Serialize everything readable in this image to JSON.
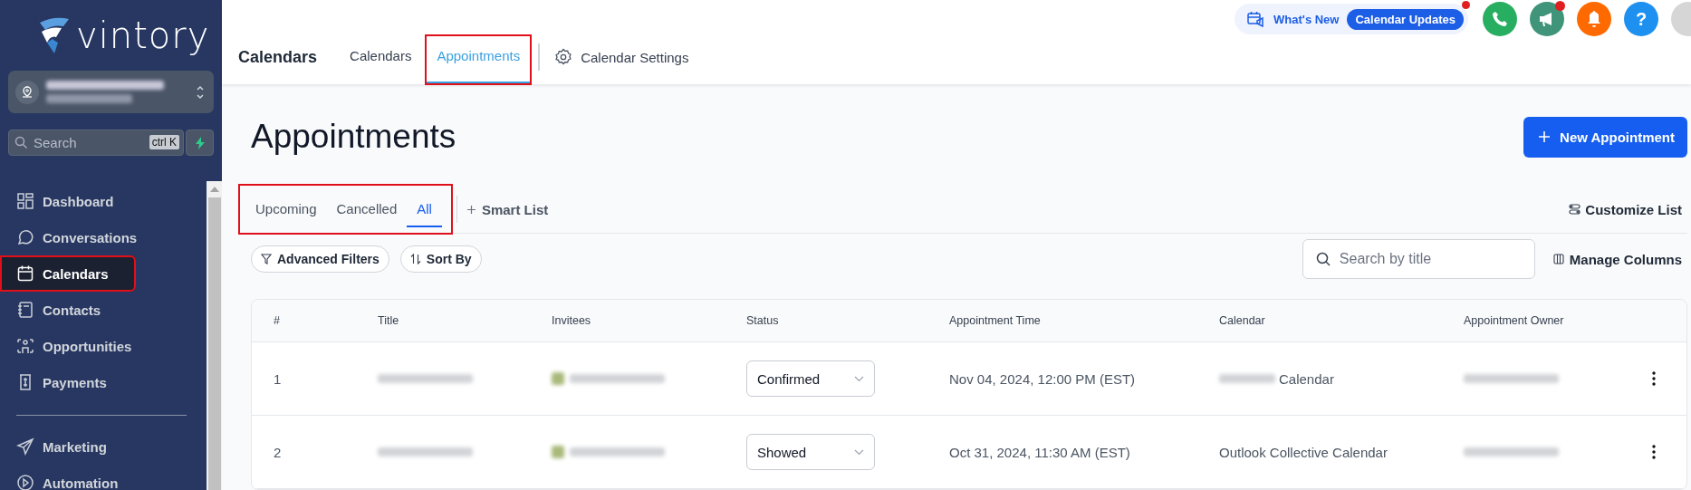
{
  "sidebar": {
    "logo": "vintory",
    "account": {
      "blurred": true
    },
    "search": {
      "placeholder": "Search",
      "shortcut": "ctrl K"
    },
    "items": [
      {
        "label": "Dashboard",
        "selected": false,
        "annotated": false
      },
      {
        "label": "Conversations",
        "selected": false,
        "annotated": false
      },
      {
        "label": "Calendars",
        "selected": true,
        "annotated": true
      },
      {
        "label": "Contacts",
        "selected": false,
        "annotated": false
      },
      {
        "label": "Opportunities",
        "selected": false,
        "annotated": false
      },
      {
        "label": "Payments",
        "selected": false,
        "annotated": false
      },
      {
        "kind": "divider"
      },
      {
        "label": "Marketing",
        "selected": false,
        "annotated": false
      },
      {
        "label": "Automation",
        "selected": false,
        "annotated": false
      }
    ]
  },
  "header": {
    "title": "Calendars",
    "tabs": [
      {
        "label": "Calendars",
        "selected": false,
        "annotated": false
      },
      {
        "label": "Appointments",
        "selected": true,
        "annotated": true
      }
    ],
    "settings": "Calendar Settings",
    "whats_new": {
      "label": "What's New",
      "badge": "Calendar Updates",
      "dot": true
    },
    "circle_buttons": [
      {
        "color": "#27ae60",
        "dot": false
      },
      {
        "color": "#3f9479",
        "dot": true
      },
      {
        "color": "#ff6a00",
        "dot": false
      },
      {
        "color": "#1e90f0",
        "dot": false,
        "text": "?"
      },
      {
        "color": "#d6d6d6",
        "dot": false
      }
    ]
  },
  "page": {
    "title": "Appointments",
    "new_button": "New Appointment",
    "list_tabs": [
      {
        "label": "Upcoming",
        "selected": false
      },
      {
        "label": "Cancelled",
        "selected": false
      },
      {
        "label": "All",
        "selected": true
      }
    ],
    "list_tabs_annotated": true,
    "smart_list": "Smart List",
    "customize": "Customize List",
    "filters": [
      "Advanced Filters",
      "Sort By"
    ],
    "search": {
      "placeholder": "Search by title"
    },
    "manage_columns": "Manage Columns"
  },
  "table": {
    "columns": [
      "#",
      "Title",
      "Invitees",
      "Status",
      "Appointment Time",
      "Calendar",
      "Appointment Owner"
    ],
    "rows": [
      {
        "num": "1",
        "title_blurred": true,
        "invitee_blurred": true,
        "status": "Confirmed",
        "time": "Nov 04, 2024, 12:00 PM (EST)",
        "calendar": "Calendar",
        "calendar_prefix_blurred": true,
        "owner_blurred": true
      },
      {
        "num": "2",
        "title_blurred": true,
        "invitee_blurred": true,
        "status": "Showed",
        "time": "Oct 31, 2024, 11:30 AM (EST)",
        "calendar": "Outlook Collective Calendar",
        "calendar_prefix_blurred": false,
        "owner_blurred": true
      }
    ]
  }
}
